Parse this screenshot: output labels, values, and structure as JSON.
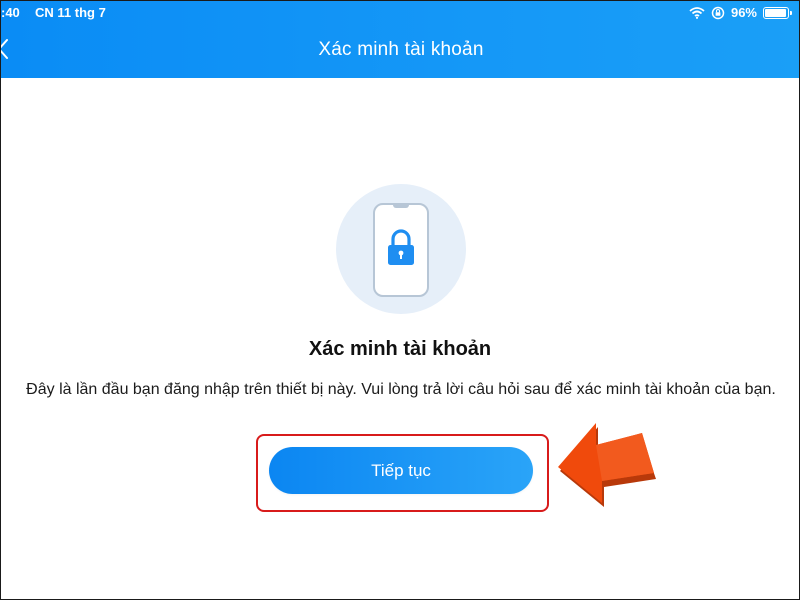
{
  "status_bar": {
    "time": ":40",
    "date": "CN 11 thg 7",
    "battery": "96%",
    "battery_level": 0.96
  },
  "header": {
    "title": "Xác minh tài khoản",
    "back_icon": "chevron-left-icon"
  },
  "illustration": {
    "icon": "phone-lock-icon"
  },
  "content": {
    "title": "Xác minh tài khoản",
    "description": "Đây là lần đầu bạn đăng nhập trên thiết bị này. Vui lòng trả lời câu hỏi sau để xác minh tài khoản của bạn."
  },
  "actions": {
    "continue_label": "Tiếp tục"
  },
  "annotation": {
    "highlight_color": "#d81b1b",
    "arrow_color": "#f04a0c"
  },
  "colors": {
    "header_blue": "#0a8cf5",
    "button_blue": "#0b86f2",
    "icon_blue": "#1f8ef1"
  }
}
